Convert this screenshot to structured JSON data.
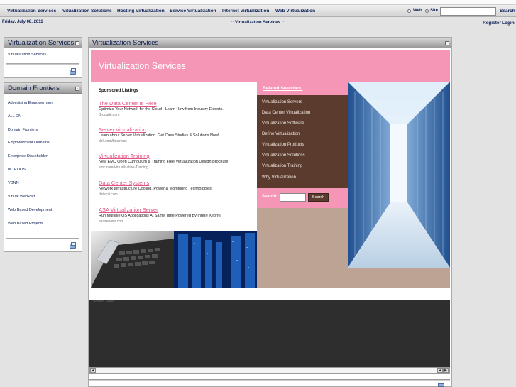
{
  "nav": {
    "items": [
      "Virtualization Services",
      "Vitualization Solutions",
      "Hosting Virtualization",
      "Service Virtualization",
      "Internet Virtualization",
      "Web Virtualization"
    ],
    "radio_web": "Web",
    "radio_site": "Site",
    "search_label": "Search"
  },
  "dateline": {
    "date": "Friday, July 08, 2011",
    "crumb": "..:: Virtualization Services ::..",
    "register": "Register",
    "login": "Login"
  },
  "sidebar": {
    "panel1": {
      "title": "Virtualization Services",
      "text": "Virtualization Services ..."
    },
    "panel2": {
      "title": "Domain Frontiers",
      "items": [
        "Advertising Empowerment",
        "ALL DN",
        "Domain Frontiers",
        "Empowerment Domains",
        "Enterprise Stakeholder",
        "INTELIOS",
        "VDNN",
        "Virtual WebPart",
        "Web Based Development",
        "Web Based Projects"
      ]
    }
  },
  "main": {
    "title": "Virtualization Services",
    "banner": "Virtualization Services",
    "sponsored": "Sponsored Listings",
    "ads": [
      {
        "title": "The Data Center Is Here",
        "desc": "Optimize Your Network for the Cloud - Learn How from Industry Experts.",
        "url": "Brocade.com"
      },
      {
        "title": "Server Virtualization",
        "desc": "Learn about Server Virtualization. Get Case Studies & Solutions Now!",
        "url": "dell.com/business"
      },
      {
        "title": "Virtualization Training",
        "desc": "New EMC Open Curriculum & Training Free Virtualization Design Brochure",
        "url": "emc.com/Virtualization-Training"
      },
      {
        "title": "Data Center Systems",
        "desc": "Network Infrastructure Cooling, Power & Monitoring Technologies",
        "url": "datacsi.com"
      },
      {
        "title": "ASA Virtualization Server",
        "desc": "Run Multiple OS Applications At Same Time Powered By Intel® Xeon®",
        "url": "asaservers.com"
      }
    ],
    "related": {
      "title": "Related Searches:",
      "items": [
        "Virtualization Servers",
        "Data Center Virtualization",
        "Virtualization Software",
        "Define Virtualization",
        "Virtualization Products",
        "Virtualization Solutions",
        "Virtualization Training",
        "Why Virtualization"
      ],
      "search_label": "Search:",
      "search_button": "Search"
    },
    "video_label": "Shared Suite"
  },
  "colors": {
    "pink": "#f596b6",
    "brown": "#5b3b2e",
    "tan": "#bda394",
    "navy": "#0b1e57"
  }
}
